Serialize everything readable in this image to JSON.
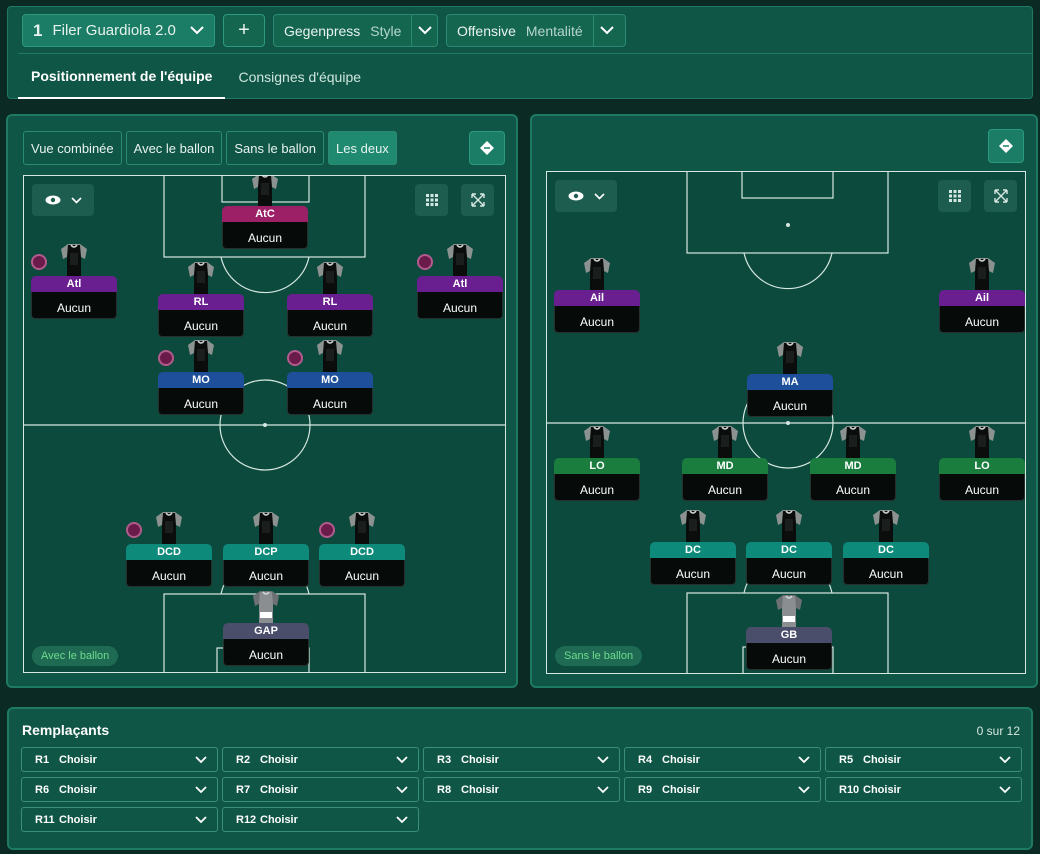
{
  "header": {
    "tactic_number": "1",
    "tactic_name": "Filer Guardiola 2.0",
    "add_label": "+",
    "style_value": "Gegenpress",
    "style_label": "Style",
    "mentality_value": "Offensive",
    "mentality_label": "Mentalité"
  },
  "tabs": [
    "Positionnement de l'équipe",
    "Consignes d'équipe"
  ],
  "view_tabs": [
    "Vue combinée",
    "Avec le ballon",
    "Sans le ballon",
    "Les deux"
  ],
  "left_panel": {
    "phase_label": "Avec le ballon",
    "players": [
      {
        "role": "AtC",
        "name": "Aucun",
        "color": "#9b2065"
      },
      {
        "role": "Atl",
        "name": "Aucun",
        "color": "#6a1f90"
      },
      {
        "role": "RL",
        "name": "Aucun",
        "color": "#6a1f90"
      },
      {
        "role": "RL",
        "name": "Aucun",
        "color": "#6a1f90"
      },
      {
        "role": "Atl",
        "name": "Aucun",
        "color": "#6a1f90"
      },
      {
        "role": "MO",
        "name": "Aucun",
        "color": "#1e4f9a"
      },
      {
        "role": "MO",
        "name": "Aucun",
        "color": "#1e4f9a"
      },
      {
        "role": "DCD",
        "name": "Aucun",
        "color": "#0e8a7b"
      },
      {
        "role": "DCP",
        "name": "Aucun",
        "color": "#0e8a7b"
      },
      {
        "role": "DCD",
        "name": "Aucun",
        "color": "#0e8a7b"
      },
      {
        "role": "GAP",
        "name": "Aucun",
        "color": "#4a4e6a"
      }
    ]
  },
  "right_panel": {
    "phase_label": "Sans le ballon",
    "players": [
      {
        "role": "Ail",
        "name": "Aucun",
        "color": "#6a1f90"
      },
      {
        "role": "Ail",
        "name": "Aucun",
        "color": "#6a1f90"
      },
      {
        "role": "MA",
        "name": "Aucun",
        "color": "#1e4f9a"
      },
      {
        "role": "LO",
        "name": "Aucun",
        "color": "#1a7d3e"
      },
      {
        "role": "MD",
        "name": "Aucun",
        "color": "#1a7d3e"
      },
      {
        "role": "MD",
        "name": "Aucun",
        "color": "#1a7d3e"
      },
      {
        "role": "LO",
        "name": "Aucun",
        "color": "#1a7d3e"
      },
      {
        "role": "DC",
        "name": "Aucun",
        "color": "#0e8a7b"
      },
      {
        "role": "DC",
        "name": "Aucun",
        "color": "#0e8a7b"
      },
      {
        "role": "DC",
        "name": "Aucun",
        "color": "#0e8a7b"
      },
      {
        "role": "GB",
        "name": "Aucun",
        "color": "#4a4e6a"
      }
    ]
  },
  "subs": {
    "title": "Remplaçants",
    "count": "0 sur 12",
    "slots": [
      {
        "code": "R1",
        "value": "Choisir"
      },
      {
        "code": "R2",
        "value": "Choisir"
      },
      {
        "code": "R3",
        "value": "Choisir"
      },
      {
        "code": "R4",
        "value": "Choisir"
      },
      {
        "code": "R5",
        "value": "Choisir"
      },
      {
        "code": "R6",
        "value": "Choisir"
      },
      {
        "code": "R7",
        "value": "Choisir"
      },
      {
        "code": "R8",
        "value": "Choisir"
      },
      {
        "code": "R9",
        "value": "Choisir"
      },
      {
        "code": "R10",
        "value": "Choisir"
      },
      {
        "code": "R11",
        "value": "Choisir"
      },
      {
        "code": "R12",
        "value": "Choisir"
      }
    ]
  },
  "icons": {
    "chevron": "chevron-down-icon",
    "eye": "eye-icon",
    "grid": "grid-icon",
    "expand": "expand-icon",
    "swap": "swap-icon"
  }
}
